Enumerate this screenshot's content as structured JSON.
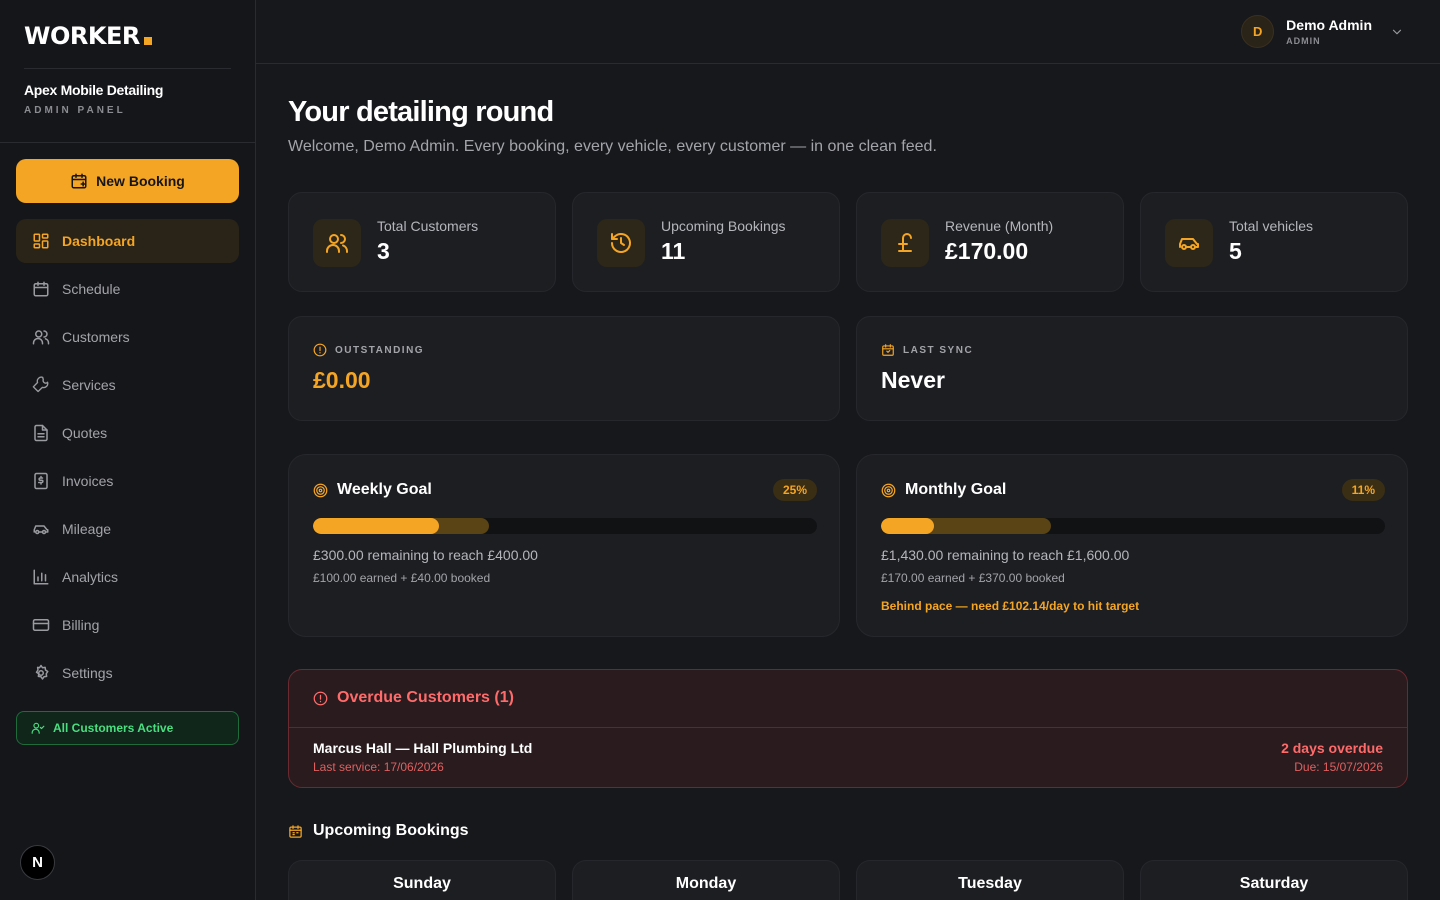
{
  "brand": {
    "name": "WORKER",
    "company": "Apex Mobile Detailing",
    "panel": "ADMIN PANEL"
  },
  "sidebar": {
    "new_booking": "New Booking",
    "items": [
      {
        "label": "Dashboard",
        "icon": "dashboard-icon"
      },
      {
        "label": "Schedule",
        "icon": "calendar-icon"
      },
      {
        "label": "Customers",
        "icon": "users-icon"
      },
      {
        "label": "Services",
        "icon": "wrench-icon"
      },
      {
        "label": "Quotes",
        "icon": "document-icon"
      },
      {
        "label": "Invoices",
        "icon": "invoice-icon"
      },
      {
        "label": "Mileage",
        "icon": "car-icon"
      },
      {
        "label": "Analytics",
        "icon": "bar-chart-icon"
      },
      {
        "label": "Billing",
        "icon": "credit-card-icon"
      },
      {
        "label": "Settings",
        "icon": "gear-icon"
      }
    ],
    "status": "All Customers Active",
    "badge": "N"
  },
  "user": {
    "initial": "D",
    "name": "Demo Admin",
    "role": "ADMIN"
  },
  "page": {
    "title": "Your detailing round",
    "subtitle": "Welcome, Demo Admin. Every booking, every vehicle, every customer — in one clean feed."
  },
  "stats": [
    {
      "label": "Total Customers",
      "value": "3",
      "icon": "users-icon"
    },
    {
      "label": "Upcoming Bookings",
      "value": "11",
      "icon": "history-icon"
    },
    {
      "label": "Revenue (Month)",
      "value": "£170.00",
      "icon": "pound-icon"
    },
    {
      "label": "Total vehicles",
      "value": "5",
      "icon": "car-icon"
    }
  ],
  "info": {
    "outstanding": {
      "label": "OUTSTANDING",
      "value": "£0.00"
    },
    "last_sync": {
      "label": "LAST SYNC",
      "value": "Never"
    }
  },
  "goals": {
    "weekly": {
      "title": "Weekly Goal",
      "pct": "25%",
      "earned_fraction": 0.25,
      "booked_fraction": 0.35,
      "remaining": "£300.00 remaining to reach £400.00",
      "breakdown": "£100.00 earned + £40.00 booked"
    },
    "monthly": {
      "title": "Monthly Goal",
      "pct": "11%",
      "earned_fraction": 0.106,
      "booked_fraction": 0.337,
      "remaining": "£1,430.00 remaining to reach £1,600.00",
      "breakdown": "£170.00 earned + £370.00 booked",
      "warning": "Behind pace — need £102.14/day to hit target"
    }
  },
  "overdue": {
    "title": "Overdue Customers (1)",
    "customer": "Marcus Hall — Hall Plumbing Ltd",
    "last_service": "Last service: 17/06/2026",
    "days": "2 days overdue",
    "due": "Due: 15/07/2026"
  },
  "upcoming": {
    "title": "Upcoming Bookings",
    "days": [
      "Sunday",
      "Monday",
      "Tuesday",
      "Saturday"
    ]
  },
  "colors": {
    "accent": "#f5a524",
    "danger": "#ff6b6b",
    "success": "#4ade80",
    "background": "#17181c"
  }
}
